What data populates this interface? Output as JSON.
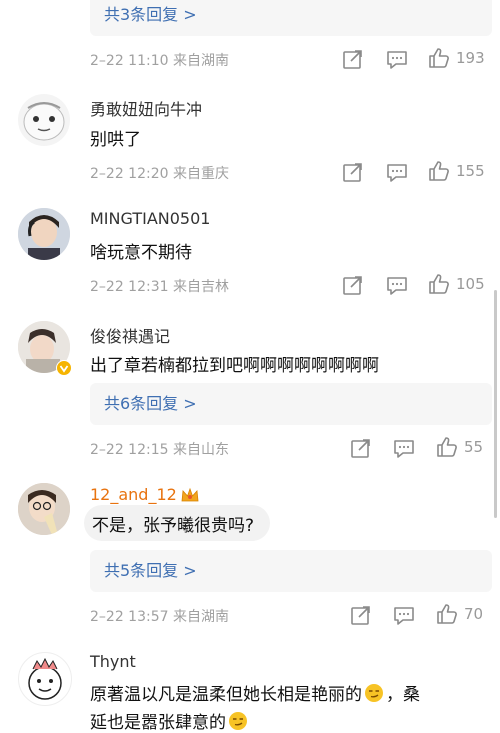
{
  "comments": [
    {
      "reply_link": "共3条回复 >",
      "meta": "2–22 11:10  来自湖南",
      "likes": "193"
    },
    {
      "username": "勇敢妞妞向牛冲",
      "content": "别哄了",
      "meta": "2–22 12:20  来自重庆",
      "likes": "155"
    },
    {
      "username": "MINGTIAN0501",
      "content": "啥玩意不期待",
      "meta": "2–22 12:31  来自吉林",
      "likes": "105"
    },
    {
      "username": "俊俊祺遇记",
      "content": "出了章若楠都拉到吧啊啊啊啊啊啊啊啊",
      "reply_link": "共6条回复 >",
      "meta": "2–22 12:15  来自山东",
      "likes": "55"
    },
    {
      "username": "12_and_12",
      "content": "不是，张予曦很贵吗?",
      "reply_link": "共5条回复 >",
      "meta": "2–22 13:57  来自湖南",
      "likes": "70"
    },
    {
      "username": "Thynt",
      "content_line1": "原著温以凡是温柔但她长相是艳丽的",
      "content_line1_tail": "，桑",
      "content_line2": "延也是嚣张肆意的"
    }
  ],
  "colors": {
    "link": "#3f6fb2",
    "meta": "#a0a0a0",
    "icon": "#8a8a8a",
    "orange_name": "#e8730f",
    "reply_bg": "#f6f6f6"
  },
  "icons": {
    "forward": "forward-icon",
    "comment": "comment-icon",
    "like": "thumbs-up-icon",
    "vip": "vip-badge-icon",
    "crown": "crown-badge-icon",
    "emoji": "smirk-emoji-icon"
  }
}
